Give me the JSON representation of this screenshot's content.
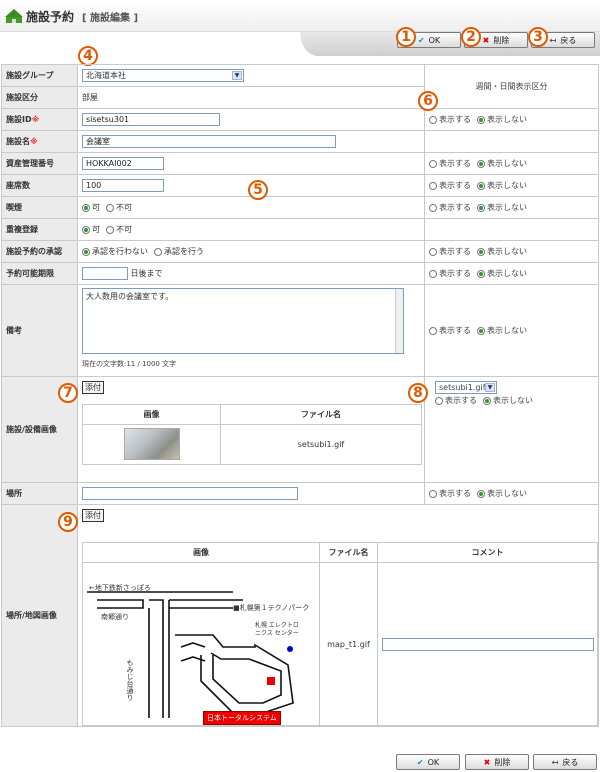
{
  "header": {
    "title": "施設予約",
    "subtitle": "[ 施設編集 ]"
  },
  "toolbar": {
    "ok": "OK",
    "delete": "削除",
    "back": "戻る"
  },
  "markers": [
    "1",
    "2",
    "3",
    "4",
    "5",
    "6",
    "7",
    "8",
    "9"
  ],
  "form": {
    "group": {
      "label": "施設グループ",
      "value": "北海道本社"
    },
    "kind": {
      "label": "施設区分",
      "value": "部屋"
    },
    "side_header": "週間・日間表示区分",
    "id": {
      "label": "施設ID",
      "req": "※",
      "value": "sisetsu301"
    },
    "name": {
      "label": "施設名",
      "req": "※",
      "value": "会議室"
    },
    "asset": {
      "label": "資産管理番号",
      "value": "HOKKAI002"
    },
    "seats": {
      "label": "座席数",
      "value": "100"
    },
    "smoking": {
      "label": "喫煙",
      "opt1": "可",
      "opt2": "不可"
    },
    "dup": {
      "label": "重複登録",
      "opt1": "可",
      "opt2": "不可"
    },
    "approval": {
      "label": "施設予約の承認",
      "opt1": "承認を行わない",
      "opt2": "承認を行う"
    },
    "limit": {
      "label": "予約可能期限",
      "suffix": "日後まで"
    },
    "note": {
      "label": "備考",
      "value": "大人数用の会議室です。",
      "count": "現在の文字数:11 / 1000 文字"
    },
    "image": {
      "label": "施設/設備画像",
      "attach": "添付",
      "col_image": "画像",
      "col_file": "ファイル名",
      "file": "setsubi1.gif",
      "select": "setsubi1.gif"
    },
    "place": {
      "label": "場所"
    },
    "map": {
      "label": "場所/地図画像",
      "attach": "添付",
      "col_image": "画像",
      "col_file": "ファイル名",
      "col_comment": "コメント",
      "file": "map_t1.gif"
    },
    "show": "表示する",
    "hide": "表示しない"
  },
  "map_labels": {
    "station": "←地下鉄新さっぽろ",
    "road1": "南郷通り",
    "park": "■札幌第１テクノパーク",
    "center": "札幌 エレクトロニクス センター",
    "road2": "もみじ台通り",
    "company": "日本トータルシステム"
  },
  "colors": {
    "accent": "#e05a00",
    "required": "#e33",
    "label_bg": "#ebebeb",
    "radio_on": "#2a9a2a"
  }
}
